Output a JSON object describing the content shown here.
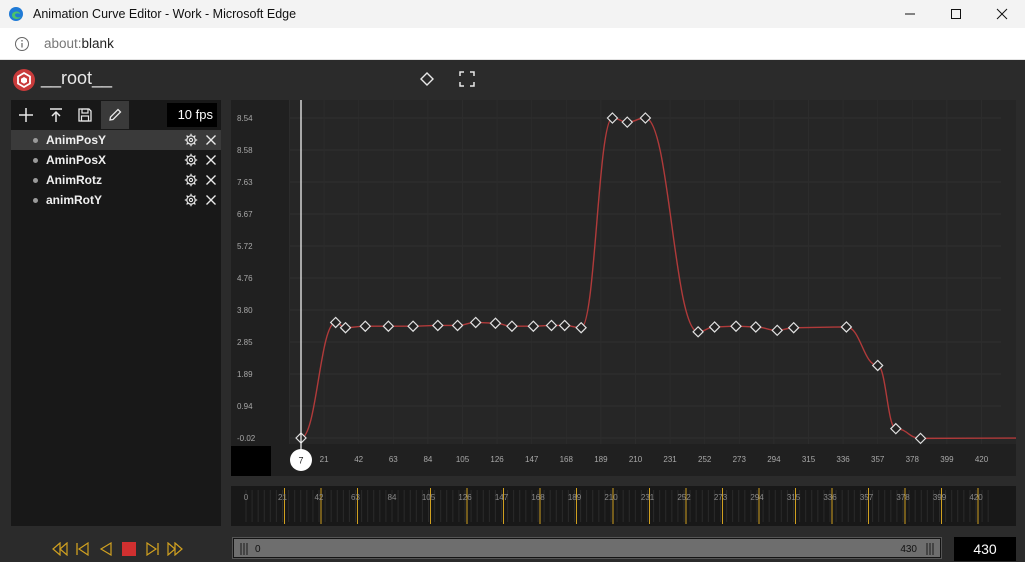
{
  "window": {
    "title": "Animation Curve Editor - Work - Microsoft Edge",
    "url_host": "about:",
    "url_path": "blank"
  },
  "app": {
    "root_name": "__root__",
    "fps_label": "10 fps",
    "frame_count": "430",
    "scroll_start": "0",
    "scroll_end": "430",
    "playhead_frame": "7"
  },
  "tracks": [
    {
      "name": "AnimPosY",
      "selected": true
    },
    {
      "name": "AminPosX",
      "selected": false
    },
    {
      "name": "AnimRotz",
      "selected": false
    },
    {
      "name": "animRotY",
      "selected": false
    }
  ],
  "chart_data": {
    "type": "line",
    "series": [
      {
        "values": [
          [
            7,
            -0.02
          ],
          [
            28,
            3.07
          ],
          [
            34,
            2.93
          ],
          [
            46,
            2.97
          ],
          [
            60,
            2.97
          ],
          [
            75,
            2.97
          ],
          [
            90,
            2.99
          ],
          [
            102,
            2.99
          ],
          [
            113,
            3.07
          ],
          [
            125,
            3.05
          ],
          [
            135,
            2.97
          ],
          [
            148,
            2.97
          ],
          [
            159,
            2.99
          ],
          [
            167,
            2.99
          ],
          [
            177,
            2.93
          ],
          [
            196,
            8.54
          ],
          [
            205,
            8.43
          ],
          [
            216,
            8.54
          ],
          [
            248,
            2.82
          ],
          [
            258,
            2.95
          ],
          [
            271,
            2.97
          ],
          [
            283,
            2.95
          ],
          [
            296,
            2.86
          ],
          [
            306,
            2.93
          ],
          [
            338,
            2.95
          ],
          [
            357,
            1.92
          ],
          [
            368,
            0.23
          ],
          [
            383,
            -0.03
          ],
          [
            448,
            -0.02
          ]
        ]
      }
    ],
    "y_ticks": [
      "8.54",
      "8.58",
      "7.63",
      "6.67",
      "5.72",
      "4.76",
      "3.80",
      "2.85",
      "1.89",
      "0.94",
      "-0.02"
    ],
    "x_ticks": [
      "0",
      "21",
      "42",
      "63",
      "84",
      "105",
      "126",
      "147",
      "168",
      "189",
      "210",
      "231",
      "252",
      "273",
      "294",
      "315",
      "336",
      "357",
      "378",
      "399",
      "420"
    ],
    "ylim": [
      -0.02,
      8.54
    ],
    "curve_color": "#b03a3a",
    "grid": true
  },
  "timeline": {
    "ticks": [
      "0",
      "21",
      "42",
      "63",
      "84",
      "105",
      "126",
      "147",
      "168",
      "189",
      "210",
      "231",
      "252",
      "273",
      "294",
      "315",
      "336",
      "357",
      "378",
      "399",
      "420"
    ],
    "key_frames": [
      21,
      42,
      63,
      105,
      126,
      147,
      168,
      189,
      210,
      231,
      252,
      273,
      294,
      315,
      336,
      357,
      378,
      399,
      420
    ]
  },
  "colors": {
    "accent": "#d0a020",
    "stop": "#d03030",
    "curve": "#b03a3a"
  },
  "icons": {
    "logo": "cube-logo-icon",
    "keyframe": "diamond-icon",
    "fit": "expand-icon"
  }
}
